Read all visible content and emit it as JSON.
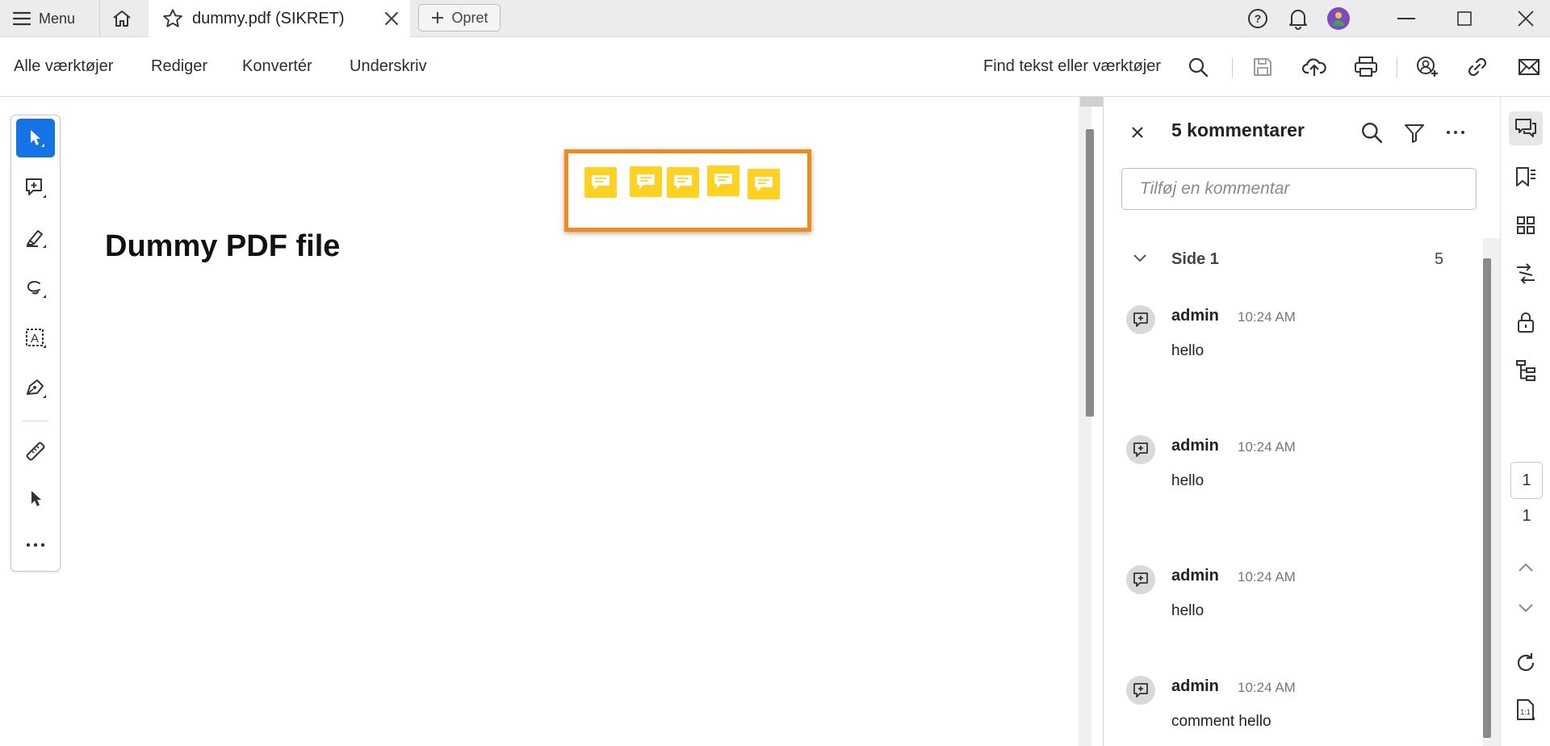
{
  "titlebar": {
    "menu_label": "Menu",
    "tab_title": "dummy.pdf (SIKRET)",
    "new_tab_label": "Opret"
  },
  "toolbar": {
    "items": [
      "Alle værktøjer",
      "Rediger",
      "Konvertér",
      "Underskriv"
    ],
    "find_label": "Find tekst eller værktøjer"
  },
  "document": {
    "title": "Dummy PDF file",
    "sticky_note_count": 5
  },
  "comments_panel": {
    "title": "5 kommentarer",
    "input_placeholder": "Tilføj en kommentar",
    "group_label": "Side 1",
    "group_count": "5",
    "comments": [
      {
        "author": "admin",
        "time": "10:24 AM",
        "text": "hello"
      },
      {
        "author": "admin",
        "time": "10:24 AM",
        "text": "hello"
      },
      {
        "author": "admin",
        "time": "10:24 AM",
        "text": "hello"
      },
      {
        "author": "admin",
        "time": "10:24 AM",
        "text": "comment hello"
      }
    ]
  },
  "page_nav": {
    "current_page": "1",
    "total_pages": "1"
  },
  "colors": {
    "accent_blue": "#1473e6",
    "sticky_note_yellow": "#ffd21f",
    "highlight_orange": "#f28a17"
  }
}
